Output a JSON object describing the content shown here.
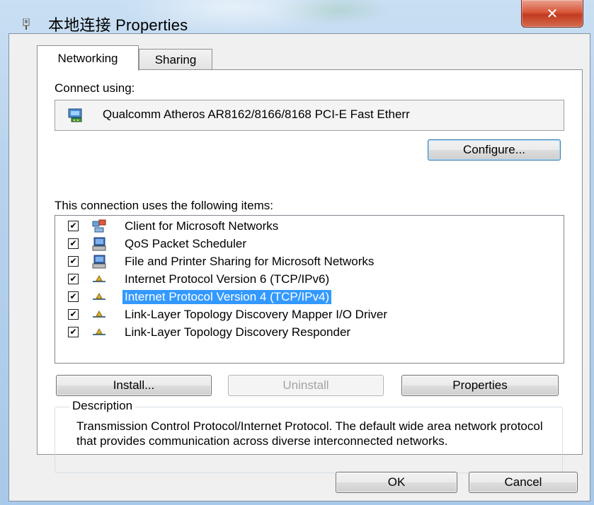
{
  "window": {
    "title": "本地连接 Properties",
    "close_glyph": "✕",
    "close_color": "#c9472b"
  },
  "tabs": [
    {
      "label": "Networking",
      "active": true
    },
    {
      "label": "Sharing",
      "active": false
    }
  ],
  "connect_using": {
    "label": "Connect using:",
    "adapter_name": "Qualcomm Atheros AR8162/8166/8168 PCI-E Fast Etherr",
    "adapter_icon": "network-adapter-icon"
  },
  "configure_button": "Configure...",
  "items_label": "This connection uses the following items:",
  "items": [
    {
      "label": "Client for Microsoft Networks",
      "checked": true,
      "icon": "network-client-icon",
      "selected": false
    },
    {
      "label": "QoS Packet Scheduler",
      "checked": true,
      "icon": "computer-service-icon",
      "selected": false
    },
    {
      "label": "File and Printer Sharing for Microsoft Networks",
      "checked": true,
      "icon": "computer-service-icon",
      "selected": false
    },
    {
      "label": "Internet Protocol Version 6 (TCP/IPv6)",
      "checked": true,
      "icon": "protocol-icon",
      "selected": false
    },
    {
      "label": "Internet Protocol Version 4 (TCP/IPv4)",
      "checked": true,
      "icon": "protocol-icon",
      "selected": true
    },
    {
      "label": "Link-Layer Topology Discovery Mapper I/O Driver",
      "checked": true,
      "icon": "protocol-icon",
      "selected": false
    },
    {
      "label": "Link-Layer Topology Discovery Responder",
      "checked": true,
      "icon": "protocol-icon",
      "selected": false
    }
  ],
  "buttons": {
    "install": "Install...",
    "uninstall": "Uninstall",
    "properties": "Properties",
    "ok": "OK",
    "cancel": "Cancel"
  },
  "description": {
    "title": "Description",
    "text": "Transmission Control Protocol/Internet Protocol. The default wide area network protocol that provides communication across diverse interconnected networks."
  },
  "colors": {
    "selection": "#3399ff",
    "default_button_border": "#3c7fb1",
    "glass": "#b7d2ec"
  }
}
